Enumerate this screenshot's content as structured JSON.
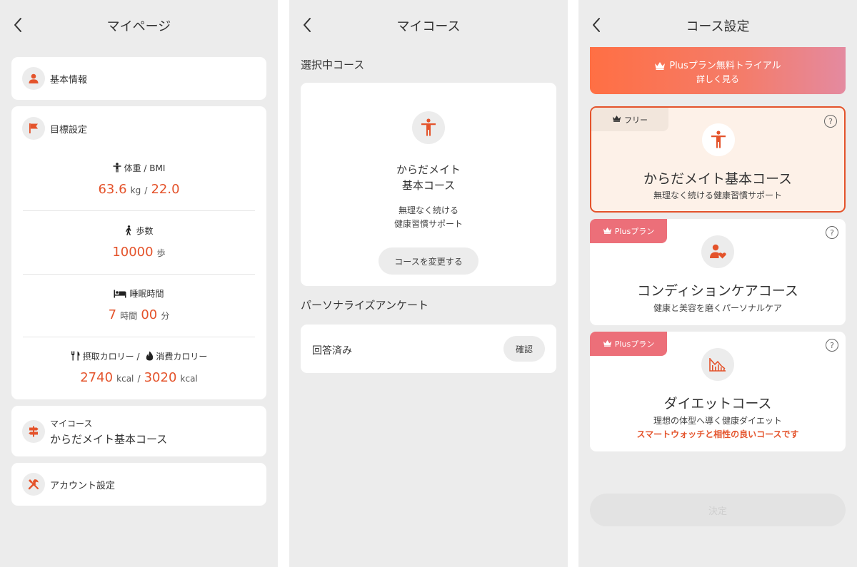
{
  "mypage": {
    "title": "マイページ",
    "basic_info": "基本情報",
    "goal_settings": "目標設定",
    "weight": {
      "label": "体重 / BMI",
      "value": "63.6",
      "unit": "kg",
      "sep": "/",
      "bmi": "22.0"
    },
    "steps": {
      "label": "歩数",
      "value": "10000",
      "unit": "歩"
    },
    "sleep": {
      "label": "睡眠時間",
      "hours": "7",
      "hours_unit": "時間",
      "minutes": "00",
      "minutes_unit": "分"
    },
    "calories": {
      "intake_label": "摂取カロリー /",
      "burn_label": "消費カロリー",
      "intake": "2740",
      "intake_unit": "kcal",
      "sep": "/",
      "burn": "3020",
      "burn_unit": "kcal"
    },
    "my_course": {
      "label": "マイコース",
      "value": "からだメイト基本コース"
    },
    "account_settings": "アカウント設定"
  },
  "mycourse": {
    "title": "マイコース",
    "selected_heading": "選択中コース",
    "course_name_line1": "からだメイト",
    "course_name_line2": "基本コース",
    "desc_line1": "無理なく続ける",
    "desc_line2": "健康習慣サポート",
    "change_button": "コースを変更する",
    "survey_heading": "パーソナライズアンケート",
    "survey_status": "回答済み",
    "confirm_button": "確認"
  },
  "course_settings": {
    "title": "コース設定",
    "banner": {
      "line1": "Plusプラン無料トライアル",
      "line2": "詳しく見る"
    },
    "courses": [
      {
        "badge": "フリー",
        "name": "からだメイト基本コース",
        "desc": "無理なく続ける健康習慣サポート"
      },
      {
        "badge": "Plusプラン",
        "name": "コンディションケアコース",
        "desc": "健康と美容を磨くパーソナルケア"
      },
      {
        "badge": "Plusプラン",
        "name": "ダイエットコース",
        "desc": "理想の体型へ導く健康ダイエット",
        "note": "スマートウォッチと相性の良いコースです"
      }
    ],
    "help": "?",
    "decide_button": "決定"
  },
  "colors": {
    "accent": "#e4532b",
    "background": "#ececec",
    "selected_card": "#fdf1e8",
    "badge_free": "#f2e6dc",
    "badge_plus": "#ec6f79"
  }
}
